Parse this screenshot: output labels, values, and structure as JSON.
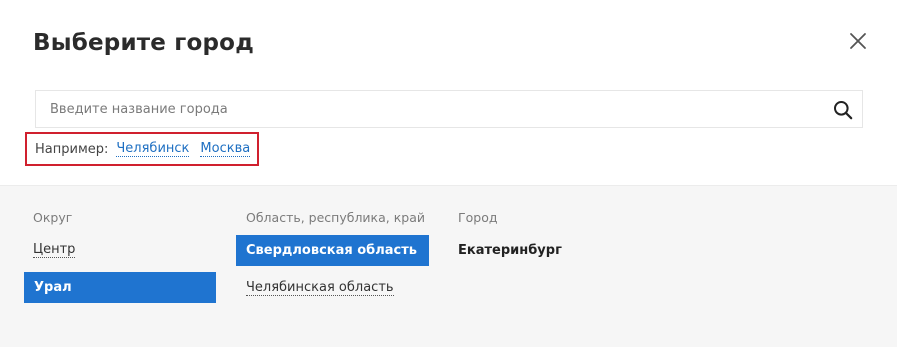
{
  "dialog": {
    "title": "Выберите город",
    "close_icon": "close-icon"
  },
  "search": {
    "placeholder": "Введите название города",
    "value": "",
    "icon": "search-icon"
  },
  "examples": {
    "label": "Например:",
    "links": [
      "Челябинск",
      "Москва"
    ]
  },
  "columns": {
    "district": {
      "header": "Округ",
      "items": [
        {
          "label": "Центр",
          "selected": false
        },
        {
          "label": "Урал",
          "selected": true
        }
      ]
    },
    "region": {
      "header": "Область, республика, край",
      "items": [
        {
          "label": "Свердловская область",
          "selected": true
        },
        {
          "label": "Челябинская область",
          "selected": false
        }
      ]
    },
    "city": {
      "header": "Город",
      "items": [
        {
          "label": "Екатеринбург",
          "selected": false
        }
      ]
    }
  },
  "colors": {
    "accent": "#1f74d0",
    "link": "#1e6fc2",
    "highlight_border": "#d0202e",
    "panel_bg": "#f6f6f6"
  }
}
